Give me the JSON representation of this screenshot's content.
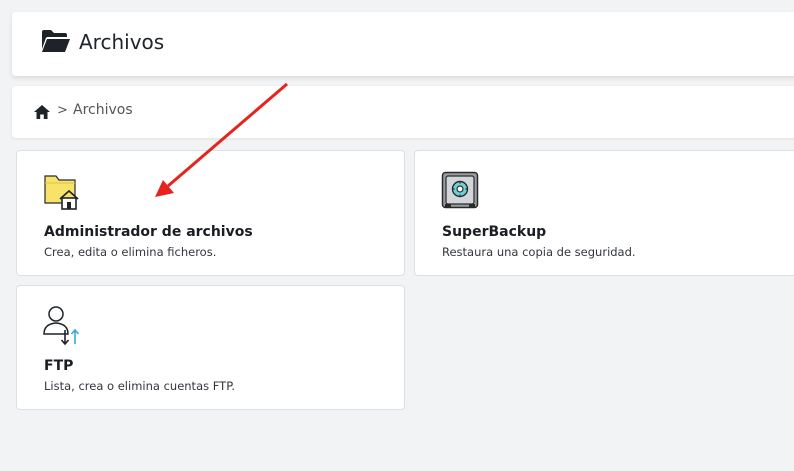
{
  "header": {
    "title": "Archivos",
    "icon": "folder-open-icon"
  },
  "breadcrumb": {
    "home_icon": "home-icon",
    "separator": ">",
    "current": "Archivos"
  },
  "cards": [
    {
      "title": "Administrador de archivos",
      "description": "Crea, edita o elimina ficheros.",
      "icon": "folder-home-icon"
    },
    {
      "title": "SuperBackup",
      "description": "Restaura una copia de seguridad.",
      "icon": "safe-icon"
    },
    {
      "title": "FTP",
      "description": "Lista, crea o elimina cuentas FTP.",
      "icon": "user-transfer-icon"
    }
  ],
  "colors": {
    "background": "#f2f3f5",
    "arrow": "#e8221c",
    "folder_yellow": "#f7e36a"
  }
}
